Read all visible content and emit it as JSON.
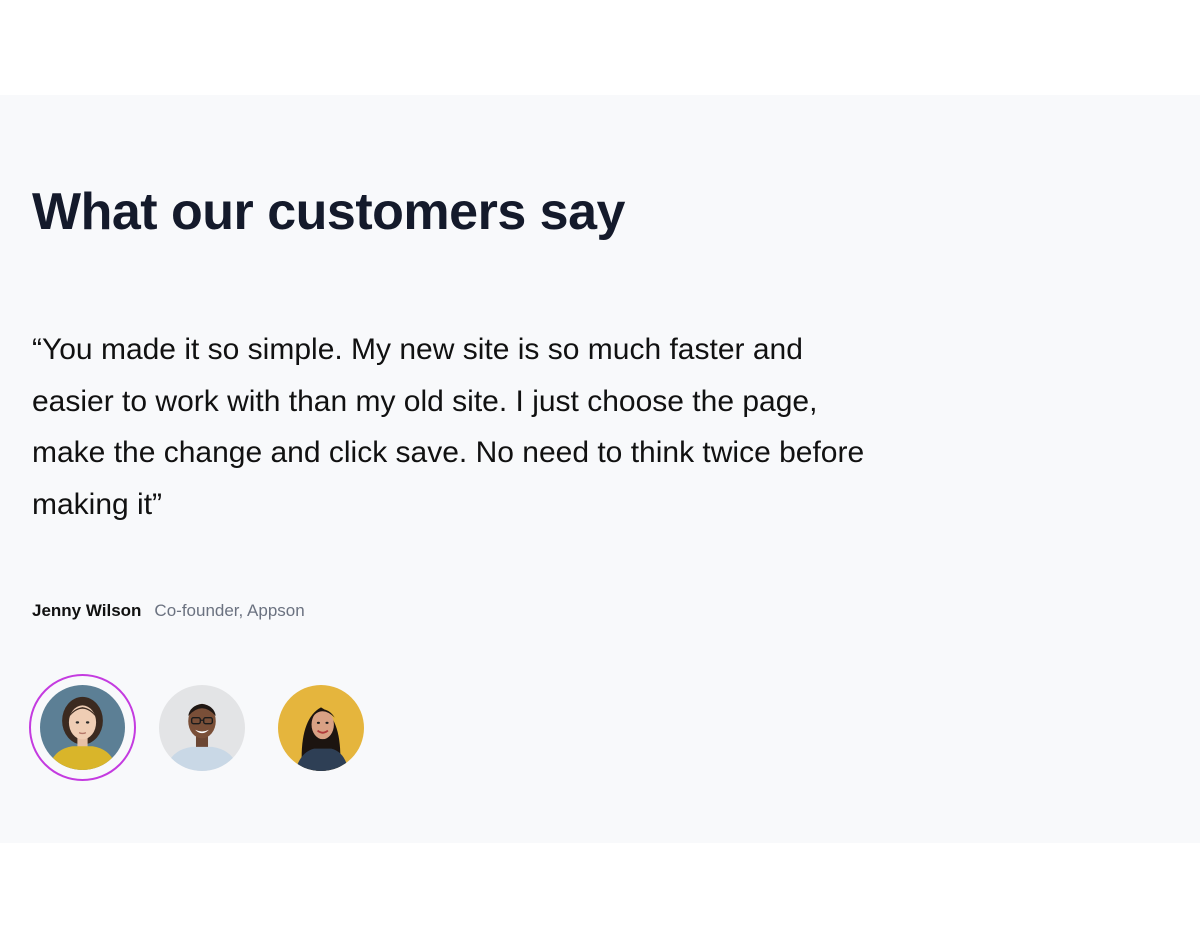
{
  "section": {
    "heading": "What our customers say"
  },
  "testimonial": {
    "quote": "“You made it so simple. My new site is so much faster and easier to work with than my old site. I just choose the page, make the change and click save. No need to think twice before making it”",
    "author_name": "Jenny Wilson",
    "author_role": "Co-founder, Appson"
  },
  "avatars": [
    {
      "icon": "avatar-woman-yellow-shirt-icon",
      "active": true
    },
    {
      "icon": "avatar-man-glasses-icon",
      "active": false
    },
    {
      "icon": "avatar-woman-yellow-background-icon",
      "active": false
    }
  ],
  "colors": {
    "section_background": "#f8f9fb",
    "heading": "#141a2b",
    "active_ring": "#c43be0",
    "role_text": "#6b7280"
  }
}
